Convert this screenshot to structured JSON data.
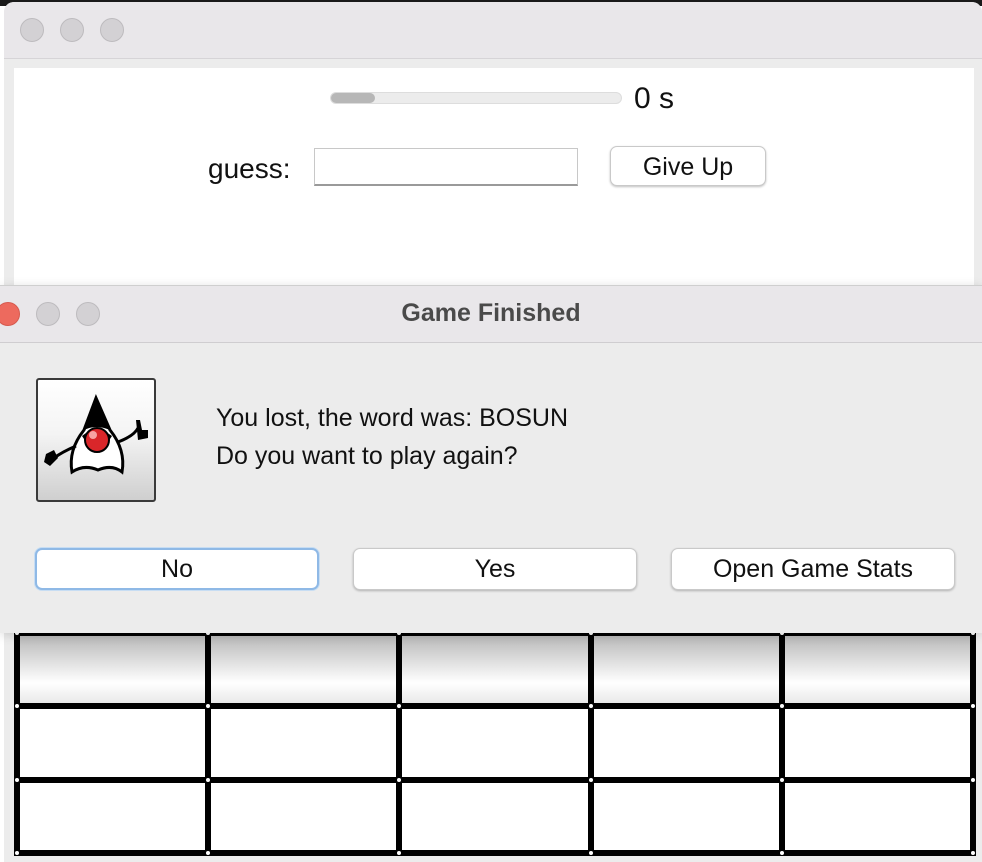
{
  "game_window": {
    "timer": {
      "progress_fraction": 0.15,
      "time_text": "0 s"
    },
    "guess_label": "guess:",
    "guess_value": "",
    "give_up_label": "Give Up",
    "board": {
      "rows": 3,
      "columns": 5
    }
  },
  "dialog": {
    "title": "Game Finished",
    "icon": "java-duke-icon",
    "message_line1": "You lost, the word was: BOSUN",
    "message_line2": "Do you want to play again?",
    "buttons": {
      "no": "No",
      "yes": "Yes",
      "stats": "Open Game Stats"
    }
  },
  "colors": {
    "close_button_red": "#ed6a5e",
    "traffic_inactive": "#d3d1d4",
    "default_button_focus": "#8fb9e6",
    "duke_nose_red": "#d9262a"
  }
}
